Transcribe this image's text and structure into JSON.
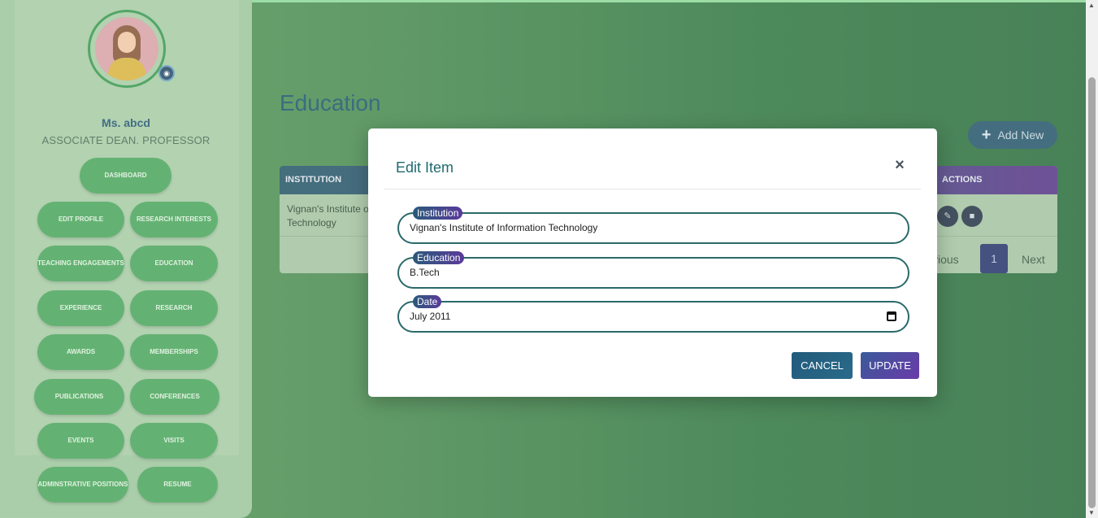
{
  "sidebar": {
    "user_name": "Ms. abcd",
    "user_role": "ASSOCIATE DEAN. PROFESSOR",
    "camera_icon": "camera-icon",
    "nav": {
      "dashboard": "DASHBOARD",
      "edit_profile": "EDIT PROFILE",
      "research_interests": "RESEARCH INTERESTS",
      "teaching_engagements": "TEACHING ENGAGEMENTS",
      "education": "EDUCATION",
      "experience": "EXPERIENCE",
      "research": "RESEARCH",
      "awards": "AWARDS",
      "memberships": "MEMBERSHIPS",
      "publications": "PUBLICATIONS",
      "conferences": "CONFERENCES",
      "events": "EVENTS",
      "visits": "VISITS",
      "administrative_positions": "ADMINSTRATIVE POSITIONS",
      "resume": "RESUME"
    }
  },
  "main": {
    "title": "Education",
    "add_new": "Add New",
    "table": {
      "columns": {
        "institution": "INSTITUTION",
        "actions": "ACTIONS"
      },
      "rows": [
        {
          "institution": "Vignan's Institute of Technology"
        }
      ],
      "pagination": {
        "previous": "vious",
        "page": "1",
        "next": "Next"
      }
    }
  },
  "modal": {
    "title": "Edit Item",
    "close": "×",
    "fields": {
      "institution": {
        "label": "Institution",
        "value": "Vignan's Institute of Information Technology"
      },
      "education": {
        "label": "Education",
        "value": "B.Tech"
      },
      "date": {
        "label": "Date",
        "value": "July 2011"
      }
    },
    "cancel": "CANCEL",
    "update": "UPDATE"
  },
  "colors": {
    "accent_green": "#4fa860",
    "header_gradient_start": "#2a5a6a",
    "header_gradient_end": "#5c3a8a",
    "title_teal": "#1f6a70"
  }
}
